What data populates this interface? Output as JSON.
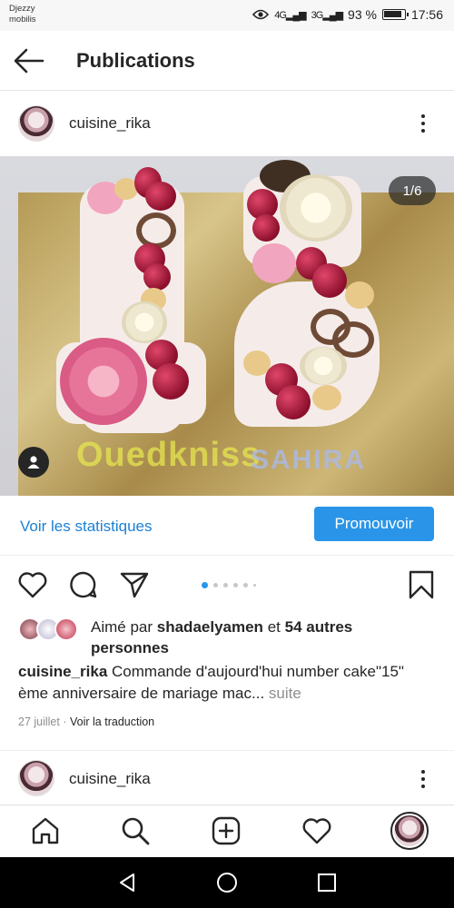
{
  "status_bar": {
    "carrier_line1": "Djezzy",
    "carrier_line2": "mobilis",
    "signal_1": "4G",
    "signal_2": "3G",
    "battery": "93 %",
    "time": "17:56"
  },
  "header": {
    "title": "Publications"
  },
  "post": {
    "username": "cuisine_rika",
    "image_counter": "1/6",
    "watermark_1": "Ouedkniss",
    "watermark_2": "SAHIRA",
    "insights": {
      "stats_link": "Voir les statistiques",
      "promote_button": "Promouvoir"
    },
    "carousel": {
      "count": 6,
      "active": 1
    },
    "likes": {
      "prefix": "Aimé par",
      "user": "shadaelyamen",
      "conjunction": "et",
      "others": "54 autres personnes"
    },
    "caption": {
      "username": "cuisine_rika",
      "text": "Commande d'aujourd'hui number cake\"15\" ème anniversaire de mariage mac...",
      "more": "suite"
    },
    "date": "27 juillet",
    "separator": "·",
    "translate": "Voir la traduction"
  },
  "next_post": {
    "username": "cuisine_rika"
  },
  "bottom_nav": {
    "items": [
      "home-icon",
      "search-icon",
      "add-icon",
      "heart-icon",
      "profile-avatar"
    ]
  },
  "colors": {
    "link_blue": "#1c80d6",
    "button_blue": "#2a95e8",
    "text": "#262626",
    "muted": "#8e8e8e"
  }
}
